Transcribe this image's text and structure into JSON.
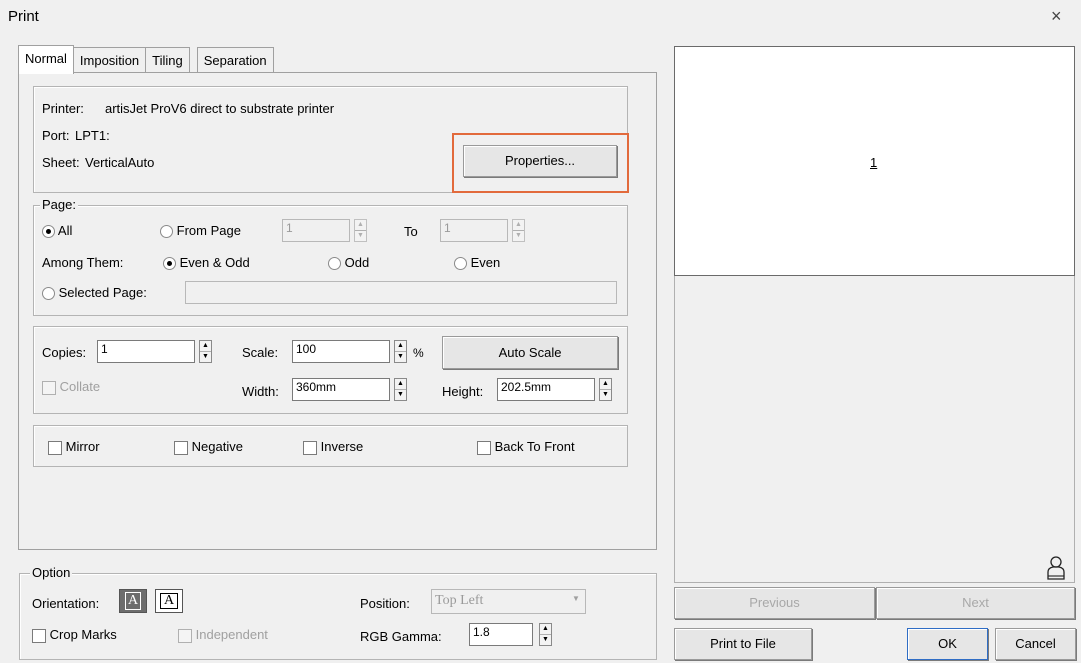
{
  "window": {
    "title": "Print",
    "close_glyph": "×"
  },
  "tabs": [
    "Normal",
    "Imposition",
    "Tiling",
    "Separation"
  ],
  "printer": {
    "printer_label": "Printer:",
    "printer_value": "artisJet ProV6 direct to substrate printer",
    "port_label": "Port:",
    "port_value": "LPT1:",
    "sheet_label": "Sheet:",
    "sheet_value": "VerticalAuto",
    "properties_button": "Properties..."
  },
  "page": {
    "legend": "Page:",
    "all": "All",
    "from_page": "From Page",
    "from_value": "1",
    "to": "To",
    "to_value": "1",
    "among_them": "Among Them:",
    "even_odd": "Even & Odd",
    "odd": "Odd",
    "even": "Even",
    "selected_page": "Selected Page:",
    "selected_value": ""
  },
  "copies": {
    "copies_label": "Copies:",
    "copies_value": "1",
    "scale_label": "Scale:",
    "scale_value": "100",
    "percent": "%",
    "auto_scale": "Auto Scale",
    "collate": "Collate",
    "width_label": "Width:",
    "width_value": "360mm",
    "height_label": "Height:",
    "height_value": "202.5mm"
  },
  "effects": {
    "mirror": "Mirror",
    "negative": "Negative",
    "inverse": "Inverse",
    "back_to_front": "Back To Front"
  },
  "option": {
    "legend": "Option",
    "orientation": "Orientation:",
    "orient_glyph": "A",
    "position_label": "Position:",
    "position_value": "Top Left",
    "crop_marks": "Crop Marks",
    "independent": "Independent",
    "rgb_gamma": "RGB Gamma:",
    "rgb_gamma_value": "1.8"
  },
  "preview": {
    "page_number": "1",
    "previous": "Previous",
    "next": "Next"
  },
  "footer": {
    "print_to_file": "Print to File",
    "ok": "OK",
    "cancel": "Cancel"
  },
  "colors": {
    "highlight": "#e26a3c",
    "window_bg": "#f0f0f0"
  },
  "icons": [
    "close-icon",
    "spin-up-icon",
    "spin-down-icon",
    "dropdown-arrow-icon",
    "person-icon"
  ]
}
